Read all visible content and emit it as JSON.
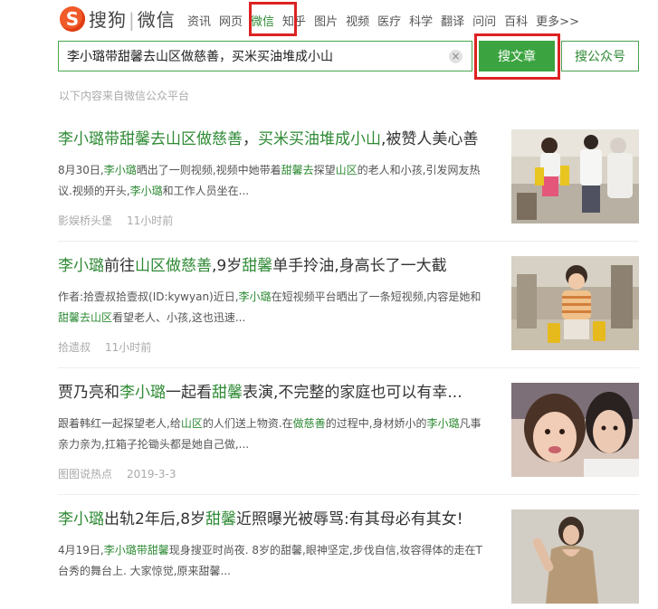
{
  "logo": {
    "brand": "搜狗",
    "product": "微信"
  },
  "nav": [
    "资讯",
    "网页",
    "微信",
    "知乎",
    "图片",
    "视频",
    "医疗",
    "科学",
    "翻译",
    "问问",
    "百科",
    "更多>>"
  ],
  "search": {
    "query": "李小璐带甜馨去山区做慈善，买米买油堆成小山",
    "clear": "×"
  },
  "buttons": {
    "search_article": "搜文章",
    "search_account": "搜公众号"
  },
  "source_note": "以下内容来自微信公众平台",
  "results": [
    {
      "title": [
        [
          "李小璐带甜馨去山区做慈善",
          true
        ],
        [
          "，",
          false
        ],
        [
          "买米买油堆成小山",
          true
        ],
        [
          ",被赞人美心善",
          false
        ]
      ],
      "snippet": [
        [
          "8月30日,",
          false
        ],
        [
          "李小璐",
          true
        ],
        [
          "晒出了一则视频,视频中她带着",
          false
        ],
        [
          "甜馨去",
          true
        ],
        [
          "探望",
          false
        ],
        [
          "山区",
          true
        ],
        [
          "的老人和小孩,引发网友热议.视频的开头,",
          false
        ],
        [
          "李小璐",
          true
        ],
        [
          "和工作人员坐在...",
          false
        ]
      ],
      "source": "影娱桥头堡",
      "time": "11小时前"
    },
    {
      "title": [
        [
          "李小璐",
          true
        ],
        [
          "前往",
          false
        ],
        [
          "山区做慈善",
          true
        ],
        [
          ",9岁",
          false
        ],
        [
          "甜馨",
          true
        ],
        [
          "单手拎油,身高长了一大截",
          false
        ]
      ],
      "snippet": [
        [
          "作者:拾壹叔拾壹叔(ID:kywyan)近日,",
          false
        ],
        [
          "李小璐",
          true
        ],
        [
          "在短视频平台晒出了一条短视频,内容是她和",
          false
        ],
        [
          "甜馨去山区",
          true
        ],
        [
          "看望老人、小孩,这也迅速...",
          false
        ]
      ],
      "source": "拾遗叔",
      "time": "11小时前"
    },
    {
      "title": [
        [
          "贾乃亮和",
          false
        ],
        [
          "李小璐",
          true
        ],
        [
          "一起看",
          false
        ],
        [
          "甜馨",
          true
        ],
        [
          "表演,不完整的家庭也可以有幸...",
          false
        ]
      ],
      "snippet": [
        [
          "跟着韩红一起探望老人,给",
          false
        ],
        [
          "山区",
          true
        ],
        [
          "的人们送上物资.在",
          false
        ],
        [
          "做慈善",
          true
        ],
        [
          "的过程中,身材娇小的",
          false
        ],
        [
          "李小璐",
          true
        ],
        [
          "凡事亲力亲为,扛箱子抡锄头都是她自己做,...",
          false
        ]
      ],
      "source": "图图说热点",
      "time": "2019-3-3"
    },
    {
      "title": [
        [
          "李小璐",
          true
        ],
        [
          "出轨2年后,8岁",
          false
        ],
        [
          "甜馨",
          true
        ],
        [
          "近照曝光被辱骂:有其母必有其女!",
          false
        ]
      ],
      "snippet": [
        [
          "4月19日,",
          false
        ],
        [
          "李小璐带甜馨",
          true
        ],
        [
          "现身搜亚时尚夜. 8岁的甜馨,眼神坚定,步伐自信,妆容得体的走在T台秀的舞台上. 大家惊觉,原来甜馨...",
          false
        ]
      ],
      "source": "",
      "time": ""
    }
  ],
  "colors": {
    "accent": "#2e8a34",
    "button_bg": "#3ba440",
    "highlight_box": "#dd2222",
    "logo": "#f05a28"
  }
}
